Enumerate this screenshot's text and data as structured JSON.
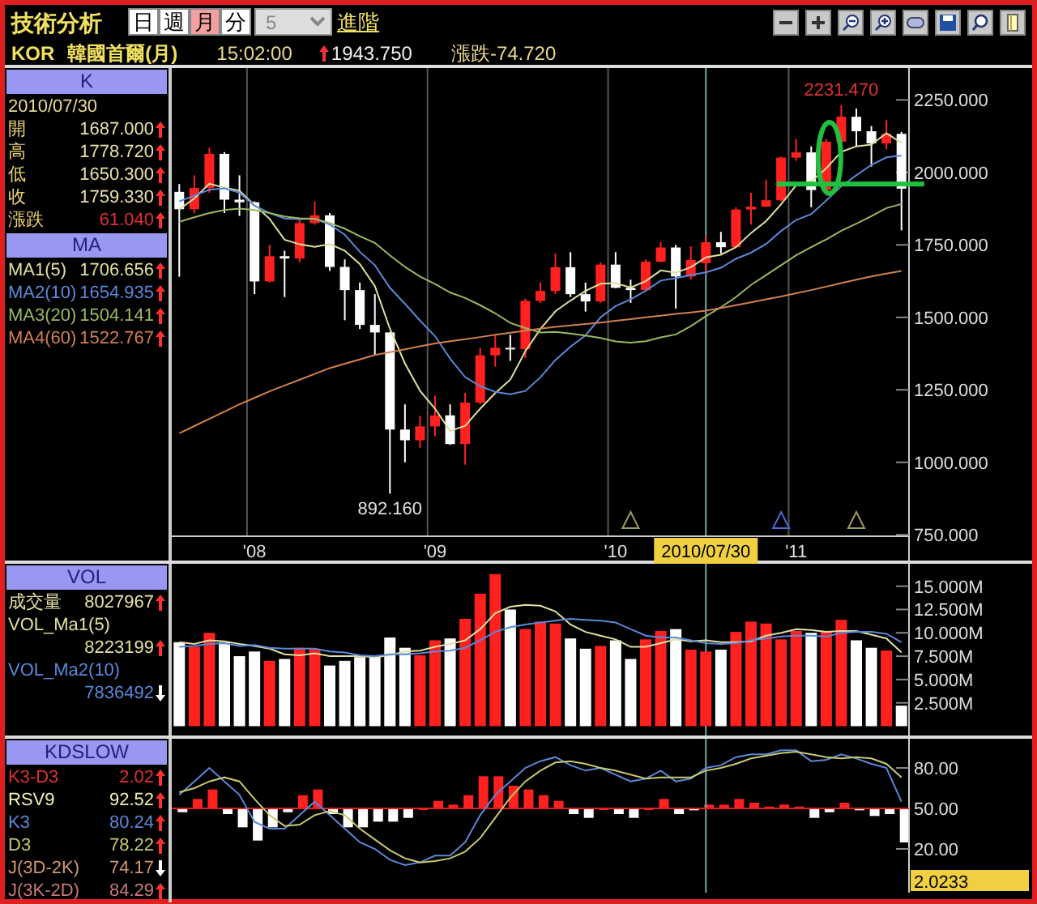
{
  "header": {
    "title": "技術分析",
    "periods": [
      {
        "label": "日",
        "selected": false
      },
      {
        "label": "週",
        "selected": false
      },
      {
        "label": "月",
        "selected": true
      },
      {
        "label": "分",
        "selected": false
      }
    ],
    "interval": {
      "value": "5",
      "disabled": true
    },
    "advanced_link": "進階"
  },
  "quote": {
    "symbol": "KOR",
    "name": "韓國首爾(月)",
    "time": "15:02:00",
    "up": true,
    "price": "1943.750",
    "change": "漲跌-74.720"
  },
  "price_panel": {
    "header": "K",
    "date": "2010/07/30",
    "rows": [
      {
        "label": "開",
        "value": "1687.000",
        "up": true,
        "color": "#e8e0a8"
      },
      {
        "label": "高",
        "value": "1778.720",
        "up": true,
        "color": "#e8e0a8"
      },
      {
        "label": "低",
        "value": "1650.300",
        "up": true,
        "color": "#e8e0a8"
      },
      {
        "label": "收",
        "value": "1759.330",
        "up": true,
        "color": "#e8e0a8"
      },
      {
        "label": "漲跌",
        "value": "61.040",
        "up": true,
        "color": "#e03030"
      }
    ],
    "ma_header": "MA",
    "ma_rows": [
      {
        "value": "1706.656",
        "up": true
      },
      {
        "value": "1654.935",
        "up": true
      },
      {
        "value": "1504.141",
        "up": true
      },
      {
        "value": "1522.767",
        "up": true
      }
    ],
    "chart_data": {
      "type": "candlestick",
      "ylim": [
        745,
        2360
      ],
      "grid": true,
      "yticks": [
        {
          "value": 2250,
          "label": "2250.000"
        },
        {
          "value": 2000,
          "label": "2000.000"
        },
        {
          "value": 1750,
          "label": "1750.000"
        },
        {
          "value": 1500,
          "label": "1500.000"
        },
        {
          "value": 1250,
          "label": "1250.000"
        },
        {
          "value": 1000,
          "label": "1000.000"
        },
        {
          "value": 750,
          "label": "750.000"
        }
      ],
      "categories": [
        null,
        null,
        null,
        null,
        null,
        "'08",
        null,
        null,
        null,
        null,
        null,
        null,
        null,
        null,
        null,
        null,
        null,
        "'09",
        null,
        null,
        null,
        null,
        null,
        null,
        null,
        null,
        null,
        null,
        null,
        "'10",
        null,
        null,
        null,
        null,
        null,
        null,
        null,
        null,
        null,
        null,
        null,
        "'11",
        null,
        null,
        null,
        null,
        null,
        null,
        null
      ],
      "series": [
        {
          "name": "MA1(5)",
          "type": "line",
          "color": "#e0e0a0",
          "values": [
            1873,
            1910,
            1961,
            1947,
            1937,
            1887,
            1840,
            1768,
            1752,
            1743,
            1753,
            1730,
            1684,
            1608,
            1461,
            1341,
            1247,
            1185,
            1108,
            1126,
            1185,
            1239,
            1285,
            1383,
            1460,
            1521,
            1558,
            1591,
            1616,
            1618,
            1603,
            1625,
            1662,
            1654,
            1673,
            1707,
            1716,
            1742,
            1791,
            1832,
            1890,
            1956,
            1969,
            2014,
            2071,
            2090,
            2096,
            2135,
            2102
          ]
        },
        {
          "name": "MA2(10)",
          "type": "line",
          "color": "#5a88d8",
          "values": [
            1900,
            1920,
            1940,
            1945,
            1930,
            1885,
            1860,
            1841,
            1839,
            1840,
            1820,
            1785,
            1726,
            1680,
            1602,
            1547,
            1489,
            1435,
            1358,
            1294,
            1263,
            1243,
            1235,
            1246,
            1293,
            1353,
            1399,
            1438,
            1500,
            1539,
            1562,
            1592,
            1627,
            1635,
            1646,
            1655,
            1671,
            1702,
            1723,
            1753,
            1798,
            1836,
            1856,
            1903,
            1952,
            1990,
            2026,
            2052,
            2058
          ]
        },
        {
          "name": "MA3(20)",
          "type": "line",
          "color": "#98b860",
          "values": [
            1830,
            1845,
            1860,
            1870,
            1875,
            1870,
            1860,
            1848,
            1842,
            1840,
            1825,
            1806,
            1780,
            1757,
            1714,
            1674,
            1641,
            1615,
            1586,
            1567,
            1542,
            1514,
            1481,
            1463,
            1448,
            1450,
            1444,
            1437,
            1429,
            1417,
            1413,
            1418,
            1431,
            1441,
            1470,
            1504,
            1535,
            1570,
            1612,
            1646,
            1680,
            1714,
            1742,
            1769,
            1799,
            1823,
            1849,
            1877,
            1891
          ]
        },
        {
          "name": "MA4(60)",
          "type": "line",
          "color": "#d08050",
          "values": [
            1100,
            1125,
            1150,
            1175,
            1200,
            1222,
            1245,
            1265,
            1285,
            1305,
            1325,
            1340,
            1355,
            1370,
            1380,
            1390,
            1400,
            1410,
            1418,
            1425,
            1432,
            1440,
            1447,
            1454,
            1461,
            1467,
            1472,
            1477,
            1482,
            1488,
            1494,
            1500,
            1506,
            1512,
            1517,
            1523,
            1532,
            1542,
            1552,
            1562,
            1572,
            1583,
            1594,
            1606,
            1618,
            1630,
            1641,
            1651,
            1660
          ]
        }
      ],
      "ohlc": [
        [
          1933,
          1960,
          1640,
          1873
        ],
        [
          1873,
          1990,
          1860,
          1946
        ],
        [
          1946,
          2085,
          1930,
          2064
        ],
        [
          2064,
          2070,
          1860,
          1906
        ],
        [
          1906,
          1990,
          1850,
          1897
        ],
        [
          1897,
          1900,
          1580,
          1624
        ],
        [
          1624,
          1750,
          1620,
          1711
        ],
        [
          1711,
          1730,
          1570,
          1703
        ],
        [
          1703,
          1840,
          1690,
          1825
        ],
        [
          1825,
          1900,
          1820,
          1852
        ],
        [
          1852,
          1860,
          1660,
          1674
        ],
        [
          1674,
          1700,
          1490,
          1594
        ],
        [
          1594,
          1620,
          1460,
          1474
        ],
        [
          1474,
          1580,
          1370,
          1448
        ],
        [
          1448,
          1450,
          892,
          1113
        ],
        [
          1113,
          1200,
          1000,
          1076
        ],
        [
          1076,
          1160,
          1050,
          1124
        ],
        [
          1124,
          1230,
          1090,
          1162
        ],
        [
          1162,
          1200,
          1060,
          1063
        ],
        [
          1063,
          1240,
          992,
          1206
        ],
        [
          1206,
          1395,
          1200,
          1369
        ],
        [
          1369,
          1440,
          1330,
          1395
        ],
        [
          1395,
          1440,
          1350,
          1390
        ],
        [
          1390,
          1565,
          1360,
          1557
        ],
        [
          1557,
          1620,
          1550,
          1591
        ],
        [
          1591,
          1720,
          1580,
          1673
        ],
        [
          1673,
          1725,
          1570,
          1580
        ],
        [
          1580,
          1620,
          1520,
          1555
        ],
        [
          1555,
          1690,
          1550,
          1682
        ],
        [
          1682,
          1725,
          1600,
          1602
        ],
        [
          1602,
          1630,
          1550,
          1594
        ],
        [
          1594,
          1700,
          1590,
          1692
        ],
        [
          1692,
          1760,
          1690,
          1741
        ],
        [
          1741,
          1750,
          1530,
          1641
        ],
        [
          1641,
          1745,
          1630,
          1698
        ],
        [
          1687,
          1779,
          1650,
          1759
        ],
        [
          1759,
          1795,
          1720,
          1742
        ],
        [
          1742,
          1880,
          1740,
          1872
        ],
        [
          1872,
          1930,
          1820,
          1882
        ],
        [
          1882,
          1975,
          1880,
          1904
        ],
        [
          1904,
          2055,
          1900,
          2051
        ],
        [
          2051,
          2115,
          2040,
          2069
        ],
        [
          2069,
          2090,
          1880,
          1939
        ],
        [
          1939,
          2115,
          1920,
          2106
        ],
        [
          2106,
          2231,
          2100,
          2192
        ],
        [
          2192,
          2220,
          2090,
          2142
        ],
        [
          2142,
          2160,
          2020,
          2100
        ],
        [
          2100,
          2180,
          2080,
          2133
        ],
        [
          2133,
          2140,
          1800,
          1944
        ]
      ],
      "annotations": [
        "2231.470",
        "892.160",
        "2010/07/30"
      ]
    }
  },
  "volume_panel": {
    "header": "VOL",
    "rows": [
      {
        "label": "成交量",
        "value": "8027967",
        "up": true,
        "color": "#e8e0a8"
      },
      {
        "value": "8223199",
        "up": true
      },
      {
        "value": "7836492",
        "up": false
      }
    ],
    "chart_data": {
      "type": "bar",
      "ylim": [
        -1,
        17.4
      ],
      "yticks": [
        {
          "value": 15,
          "label": "15.000M"
        },
        {
          "value": 12.5,
          "label": "12.500M"
        },
        {
          "value": 10,
          "label": "10.000M"
        },
        {
          "value": 7.5,
          "label": "7.500M"
        },
        {
          "value": 5,
          "label": "5.000M"
        },
        {
          "value": 2.5,
          "label": "2.500M"
        }
      ],
      "categories": [
        null,
        null,
        null,
        null,
        null,
        null,
        null,
        null,
        null,
        null,
        null,
        null,
        null,
        null,
        null,
        null,
        null,
        null,
        null,
        null,
        null,
        null,
        null,
        null,
        null,
        null,
        null,
        null,
        null,
        null,
        null,
        null,
        null,
        null,
        null,
        null,
        null,
        null,
        null,
        null,
        null,
        null,
        null,
        null,
        null,
        null,
        null,
        null,
        null
      ],
      "series": [
        {
          "color": "#ff2020",
          "values": [
            null,
            8.5,
            10,
            null,
            null,
            null,
            7,
            null,
            8.4,
            8.3,
            null,
            null,
            null,
            null,
            null,
            null,
            7.6,
            9.2,
            null,
            11.5,
            14.2,
            16.3,
            null,
            10.4,
            11.2,
            11,
            null,
            null,
            8.6,
            null,
            null,
            9.3,
            10.2,
            null,
            8.2,
            8,
            null,
            10.1,
            11.2,
            11,
            9.3,
            10.2,
            null,
            10.1,
            11.4,
            null,
            null,
            8.1,
            null
          ]
        },
        {
          "color": "#ffffff",
          "values": [
            9,
            null,
            null,
            9,
            7.5,
            8,
            null,
            7.2,
            null,
            null,
            6.5,
            7,
            7.4,
            7.6,
            9.5,
            8.4,
            null,
            null,
            9.4,
            null,
            null,
            null,
            12.5,
            null,
            null,
            null,
            9.4,
            8.3,
            null,
            9.2,
            7.2,
            null,
            null,
            10.4,
            null,
            null,
            8.2,
            null,
            null,
            null,
            null,
            null,
            10,
            null,
            null,
            9.2,
            8.4,
            null,
            2.2
          ]
        },
        {
          "name": "VOL_Ma1(5)",
          "type": "line",
          "color": "#e0e0a0",
          "values": [
            9,
            8.8,
            9.2,
            9.1,
            8.8,
            8.6,
            8.3,
            7.7,
            7.6,
            7.8,
            7.5,
            7.5,
            7.5,
            7.4,
            7.6,
            8,
            8.1,
            8.5,
            8.8,
            9.2,
            10.4,
            12.1,
            12.8,
            13,
            12.9,
            12.3,
            10.9,
            10.1,
            9.7,
            9.3,
            8.5,
            8.5,
            8.9,
            9.3,
            9.1,
            9.2,
            9,
            9,
            9.1,
            9.7,
            10,
            10.4,
            10.3,
            10.1,
            10.2,
            10.2,
            9.8,
            9.4,
            7.9
          ]
        },
        {
          "name": "VOL_Ma2(10)",
          "type": "line",
          "color": "#5a88d8",
          "values": [
            8.5,
            8.6,
            8.8,
            8.9,
            8.6,
            8.7,
            8.4,
            8.3,
            8.3,
            8.3,
            8,
            7.9,
            7.6,
            7.5,
            7.7,
            7.7,
            7.8,
            8,
            8.1,
            8.4,
            9.2,
            10.1,
            10.6,
            10.9,
            11.1,
            11.3,
            11.5,
            11.4,
            11.3,
            11.1,
            10.4,
            9.7,
            9.5,
            9.5,
            9.2,
            8.9,
            8.8,
            8.9,
            9.2,
            9.4,
            9.6,
            9.7,
            9.7,
            9.6,
            10,
            10.1,
            10.1,
            9.9,
            9
          ]
        }
      ]
    }
  },
  "kd_panel": {
    "header": "KDSLOW",
    "rows": [
      {
        "label": "K3-D3",
        "value": "2.02",
        "up": true,
        "color": "#e03030"
      },
      {
        "label": "RSV9",
        "value": "92.52",
        "up": true,
        "color": "#f0f0b0"
      },
      {
        "value": "80.24",
        "up": true
      },
      {
        "value": "78.22",
        "up": true
      },
      {
        "label": "J(3D-2K)",
        "value": "74.17",
        "up": false,
        "color": "#d09870"
      },
      {
        "label": "J(3K-2D)",
        "value": "84.29",
        "up": true,
        "color": "#c87878"
      }
    ],
    "cursor_value": "2.0233",
    "chart_data": {
      "type": "line",
      "ylim": [
        -10,
        101.6
      ],
      "yticks": [
        {
          "value": 80,
          "label": "80.00"
        },
        {
          "value": 50,
          "label": "50.00"
        },
        {
          "value": 20,
          "label": "20.00"
        }
      ],
      "ref_lines": [
        {
          "axis": "y",
          "value": 50
        }
      ],
      "series": [
        {
          "name": "K3",
          "color": "#5a88d8",
          "values": [
            60,
            70,
            80,
            70,
            60,
            40,
            35,
            35,
            45,
            55,
            45,
            35,
            25,
            20,
            12,
            8,
            10,
            15,
            15,
            25,
            45,
            60,
            70,
            80,
            85,
            88,
            82,
            78,
            80,
            75,
            70,
            72,
            78,
            70,
            72,
            80,
            82,
            88,
            90,
            90,
            93,
            93,
            85,
            86,
            90,
            87,
            83,
            80,
            55
          ]
        },
        {
          "name": "D3",
          "color": "#c8c870",
          "values": [
            62,
            65,
            70,
            73,
            70,
            57,
            45,
            37,
            38,
            45,
            48,
            45,
            35,
            27,
            19,
            13,
            10,
            11,
            13,
            18,
            28,
            43,
            58,
            70,
            78,
            84,
            85,
            83,
            80,
            78,
            75,
            72,
            73,
            73,
            73,
            78,
            80,
            83,
            87,
            89,
            91,
            92,
            90,
            88,
            87,
            88,
            87,
            83,
            73
          ]
        }
      ]
    }
  }
}
